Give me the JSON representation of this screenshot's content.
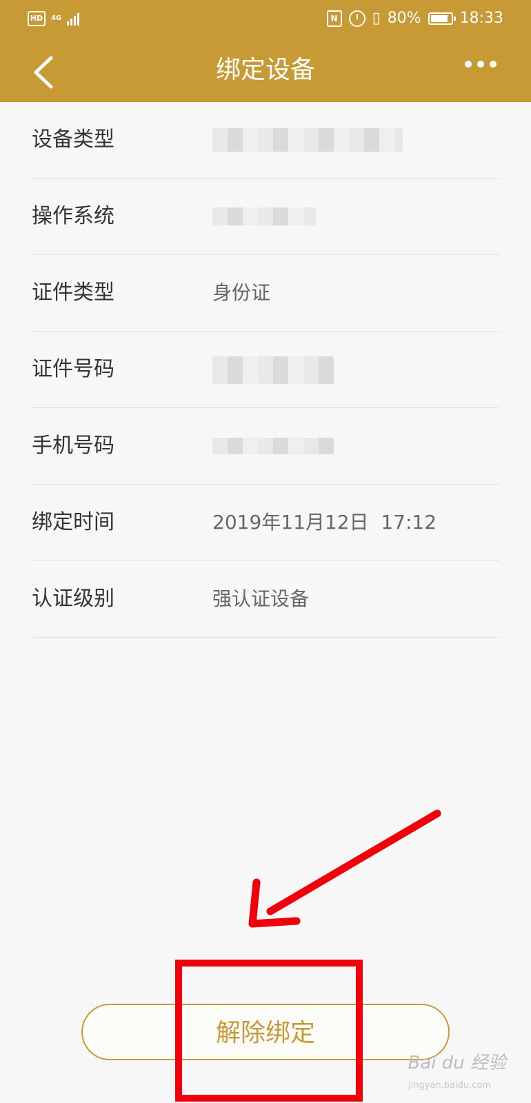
{
  "status_bar": {
    "hd_badge": "HD",
    "network": "4G",
    "battery_percent": "80%",
    "time": "18:33",
    "nfc_label": "N",
    "signal_level": 0.8
  },
  "header": {
    "title": "绑定设备",
    "back_icon": "chevron-left-icon",
    "more_icon": "more-dots-icon",
    "background_color": "#c89a36"
  },
  "details": [
    {
      "label": "设备类型",
      "value": "",
      "redacted": true
    },
    {
      "label": "操作系统",
      "value": "",
      "redacted": true
    },
    {
      "label": "证件类型",
      "value": "身份证",
      "redacted": false
    },
    {
      "label": "证件号码",
      "value": "",
      "redacted": true
    },
    {
      "label": "手机号码",
      "value": "",
      "redacted": true
    },
    {
      "label": "绑定时间",
      "value": "2019年11月12日  17:12",
      "redacted": false
    },
    {
      "label": "认证级别",
      "value": "强认证设备",
      "redacted": false
    }
  ],
  "actions": {
    "unbind_label": "解除绑定",
    "accent_color": "#c89a36"
  },
  "annotation": {
    "highlight_color": "#f0000a"
  },
  "watermark": {
    "brand": "Bai du 经验",
    "url": "jingyan.baidu.com"
  }
}
